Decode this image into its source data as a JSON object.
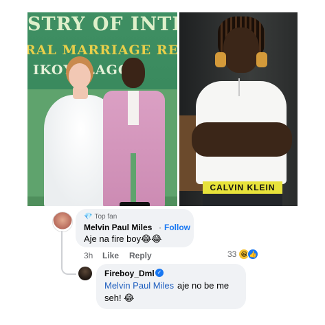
{
  "photo_left": {
    "banner_lines": [
      "STRY OF INTERIC",
      "RAL MARRIAGE REGISTI",
      "IKOYI LAGOS"
    ]
  },
  "photo_right": {
    "waistband_text": "CALVIN KLEIN"
  },
  "comment": {
    "badge": "Top fan",
    "author": "Melvin Paul Miles",
    "separator": "·",
    "follow_label": "Follow",
    "text": "Aje na fire boy😂😂",
    "time": "3h",
    "like_label": "Like",
    "reply_label": "Reply",
    "reaction_count": "33",
    "reactions": [
      "haha-icon",
      "like-icon"
    ]
  },
  "reply": {
    "author": "Fireboy_Dml",
    "mention": "Melvin Paul Miles",
    "text_line1": "aje no be me",
    "text_line2": "seh! 😂"
  },
  "colors": {
    "bubble": "#f0f2f5",
    "link": "#1877f2",
    "meta": "#65676b"
  }
}
